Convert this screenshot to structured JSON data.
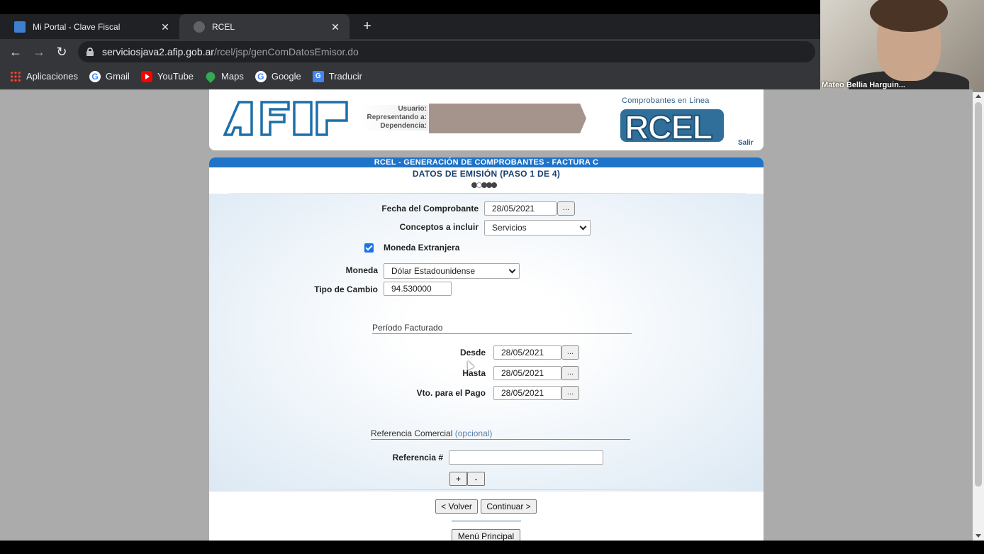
{
  "browser": {
    "tabs": [
      {
        "title": "Mi Portal - Clave Fiscal",
        "active": false
      },
      {
        "title": "RCEL",
        "active": true
      }
    ],
    "new_tab": "+",
    "close": "✕",
    "nav": {
      "back": "←",
      "forward": "→",
      "reload": "↻"
    },
    "url": {
      "host": "serviciosjava2.afip.gob.ar",
      "path": "/rcel/jsp/genComDatosEmisor.do"
    },
    "bookmarks": [
      {
        "label": "Aplicaciones",
        "icon": "apps-grid-icon"
      },
      {
        "label": "Gmail",
        "icon": "google-icon"
      },
      {
        "label": "YouTube",
        "icon": "youtube-icon"
      },
      {
        "label": "Maps",
        "icon": "maps-pin-icon"
      },
      {
        "label": "Google",
        "icon": "google-icon"
      },
      {
        "label": "Traducir",
        "icon": "translate-icon"
      }
    ]
  },
  "video": {
    "participant_name": "Mateo Bellia Harguin..."
  },
  "header": {
    "logo_text": "AFIP",
    "user_labels": [
      "Usuario:",
      "Representando a:",
      "Dependencia:"
    ],
    "rcel_subtitle": "Comprobantes en Linea",
    "rcel_logo_text": "RCEL",
    "logout": "Salir"
  },
  "form": {
    "title": "RCEL - GENERACIÓN DE COMPROBANTES - FACTURA C",
    "subtitle": "DATOS DE EMISIÓN (PASO 1 DE 4)",
    "step_current": 1,
    "step_total": 5,
    "fecha_label": "Fecha del Comprobante",
    "fecha_value": "28/05/2021",
    "picker": "...",
    "conceptos_label": "Conceptos a incluir",
    "conceptos_value": "Servicios",
    "moneda_ext_label": "Moneda Extranjera",
    "moneda_ext_checked": true,
    "moneda_label": "Moneda",
    "moneda_value": "Dólar Estadounidense",
    "tipo_cambio_label": "Tipo de Cambio",
    "tipo_cambio_value": "94.530000",
    "periodo_title": "Período Facturado",
    "desde_label": "Desde",
    "desde_value": "28/05/2021",
    "hasta_label": "Hasta",
    "hasta_value": "28/05/2021",
    "vto_label": "Vto. para el Pago",
    "vto_value": "28/05/2021",
    "referencia_title": "Referencia Comercial",
    "referencia_opt": "(opcional)",
    "referencia_label": "Referencia #",
    "referencia_value": "",
    "add_btn": "+",
    "remove_btn": "-",
    "back_btn": "< Volver",
    "continue_btn": "Continuar >",
    "menu_btn": "Menú Principal"
  },
  "colors": {
    "band": "#1f73c9",
    "title_dark": "#1a3e6e",
    "checkbox": "#1a73e8",
    "page_bg": "#ababab"
  }
}
